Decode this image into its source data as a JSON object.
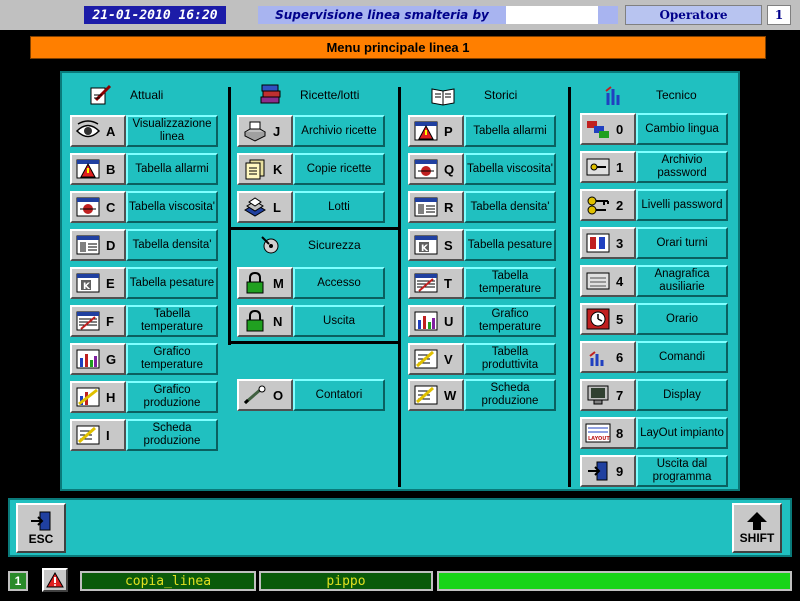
{
  "header": {
    "datetime": "21-01-2010 16:20",
    "title": "Supervisione linea smalteria by",
    "operator_label": "Operatore",
    "operator_number": "1"
  },
  "menu_title": "Menu principale linea 1",
  "columns": {
    "attuali": {
      "title": "Attuali"
    },
    "ricette": {
      "title": "Ricette/lotti"
    },
    "sicurezza": {
      "title": "Sicurezza"
    },
    "storici": {
      "title": "Storici"
    },
    "tecnico": {
      "title": "Tecnico"
    }
  },
  "buttons": {
    "A": {
      "key": "A",
      "label": "Visualizzazione linea",
      "icon": "eye-icon"
    },
    "B": {
      "key": "B",
      "label": "Tabella allarmi",
      "icon": "alarm-table-icon"
    },
    "C": {
      "key": "C",
      "label": "Tabella viscosita'",
      "icon": "viscosity-icon"
    },
    "D": {
      "key": "D",
      "label": "Tabella densita'",
      "icon": "density-icon"
    },
    "E": {
      "key": "E",
      "label": "Tabella pesature",
      "icon": "weighing-icon"
    },
    "F": {
      "key": "F",
      "label": "Tabella temperature",
      "icon": "temperature-table-icon"
    },
    "G": {
      "key": "G",
      "label": "Grafico temperature",
      "icon": "bar-chart-icon"
    },
    "H": {
      "key": "H",
      "label": "Grafico produzione",
      "icon": "production-chart-icon"
    },
    "I": {
      "key": "I",
      "label": "Scheda produzione",
      "icon": "production-sheet-icon"
    },
    "J": {
      "key": "J",
      "label": "Archivio ricette",
      "icon": "recipe-archive-icon"
    },
    "K": {
      "key": "K",
      "label": "Copie ricette",
      "icon": "copy-icon"
    },
    "L": {
      "key": "L",
      "label": "Lotti",
      "icon": "lots-icon"
    },
    "M": {
      "key": "M",
      "label": "Accesso",
      "icon": "lock-icon"
    },
    "N": {
      "key": "N",
      "label": "Uscita",
      "icon": "lock-icon"
    },
    "O": {
      "key": "O",
      "label": "Contatori",
      "icon": "counter-icon"
    },
    "P": {
      "key": "P",
      "label": "Tabella allarmi",
      "icon": "alarm-table-icon"
    },
    "Q": {
      "key": "Q",
      "label": "Tabella viscosita'",
      "icon": "viscosity-icon"
    },
    "R": {
      "key": "R",
      "label": "Tabella densita'",
      "icon": "density-icon"
    },
    "S": {
      "key": "S",
      "label": "Tabella pesature",
      "icon": "weighing-icon"
    },
    "T": {
      "key": "T",
      "label": "Tabella temperature",
      "icon": "temperature-table-icon"
    },
    "U": {
      "key": "U",
      "label": "Grafico temperature",
      "icon": "bar-chart-icon"
    },
    "V": {
      "key": "V",
      "label": "Tabella produttivita",
      "icon": "production-chart-icon"
    },
    "W": {
      "key": "W",
      "label": "Scheda produzione",
      "icon": "production-sheet-icon"
    },
    "0": {
      "key": "0",
      "label": "Cambio lingua",
      "icon": "flags-icon"
    },
    "1": {
      "key": "1",
      "label": "Archivio password",
      "icon": "password-archive-icon"
    },
    "2": {
      "key": "2",
      "label": "Livelli password",
      "icon": "keys-icon"
    },
    "3": {
      "key": "3",
      "label": "Orari turni",
      "icon": "shift-schedule-icon"
    },
    "4": {
      "key": "4",
      "label": "Anagrafica ausiliarie",
      "icon": "registry-icon"
    },
    "5": {
      "key": "5",
      "label": "Orario",
      "icon": "clock-icon"
    },
    "6": {
      "key": "6",
      "label": "Comandi",
      "icon": "commands-icon"
    },
    "7": {
      "key": "7",
      "label": "Display",
      "icon": "monitor-icon"
    },
    "8": {
      "key": "8",
      "label": "LayOut impianto",
      "icon": "layout-icon",
      "icon_text": "LAYOUT"
    },
    "9": {
      "key": "9",
      "label": "Uscita dal programma",
      "icon": "exit-icon"
    }
  },
  "footer": {
    "esc_label": "ESC",
    "shift_label": "SHIFT"
  },
  "status": {
    "number": "1",
    "recipe": "copia_linea",
    "user": "pippo"
  },
  "colors": {
    "panel": "#20c0c0",
    "menu_bar": "#ff7f00",
    "status_green": "#0a5a0a",
    "status_bright": "#18d418"
  }
}
